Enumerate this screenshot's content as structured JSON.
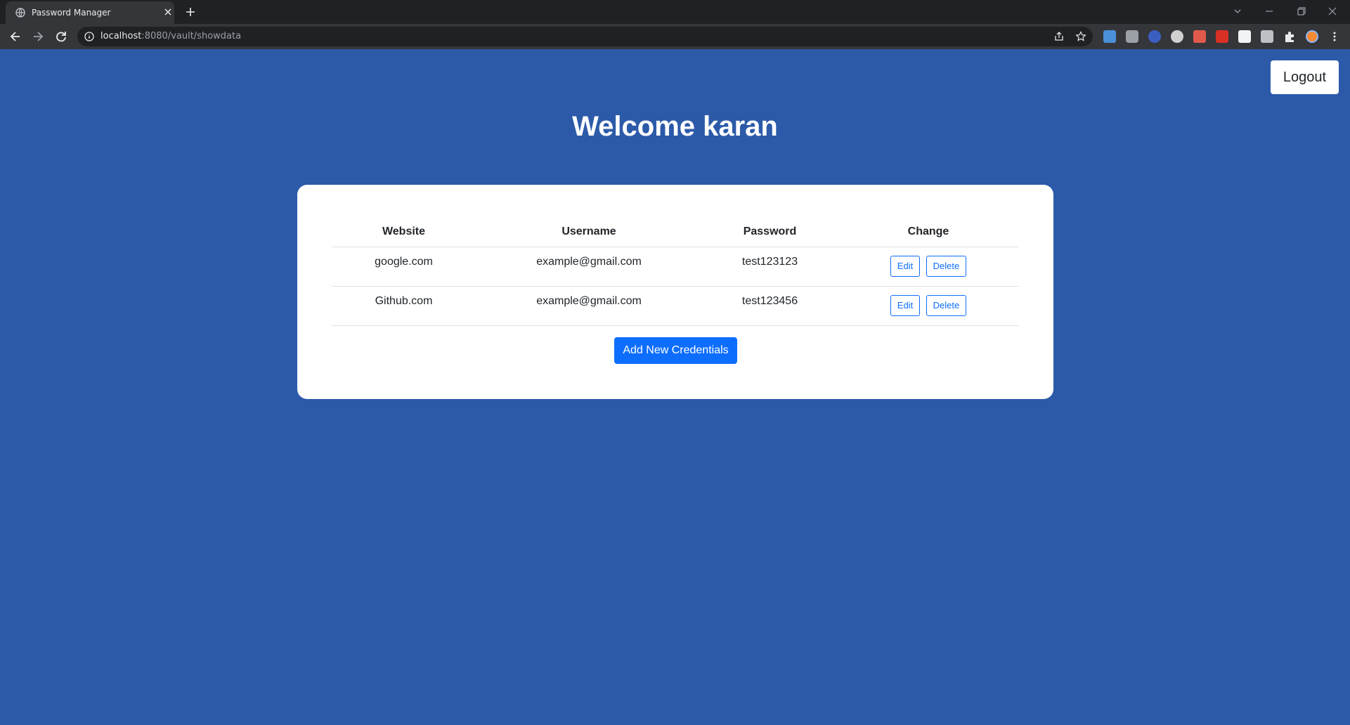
{
  "browser": {
    "tab_title": "Password Manager",
    "url_host": "localhost",
    "url_rest": ":8080/vault/showdata"
  },
  "page": {
    "logout_label": "Logout",
    "welcome": "Welcome karan",
    "table": {
      "headers": [
        "Website",
        "Username",
        "Password",
        "Change"
      ],
      "rows": [
        {
          "website": "google.com",
          "username": "example@gmail.com",
          "password": "test123123"
        },
        {
          "website": "Github.com",
          "username": "example@gmail.com",
          "password": "test123456"
        }
      ],
      "edit_label": "Edit",
      "delete_label": "Delete"
    },
    "add_button": "Add New Credentials"
  },
  "colors": {
    "page_background": "#2c5aa9",
    "primary": "#0d6efd"
  }
}
